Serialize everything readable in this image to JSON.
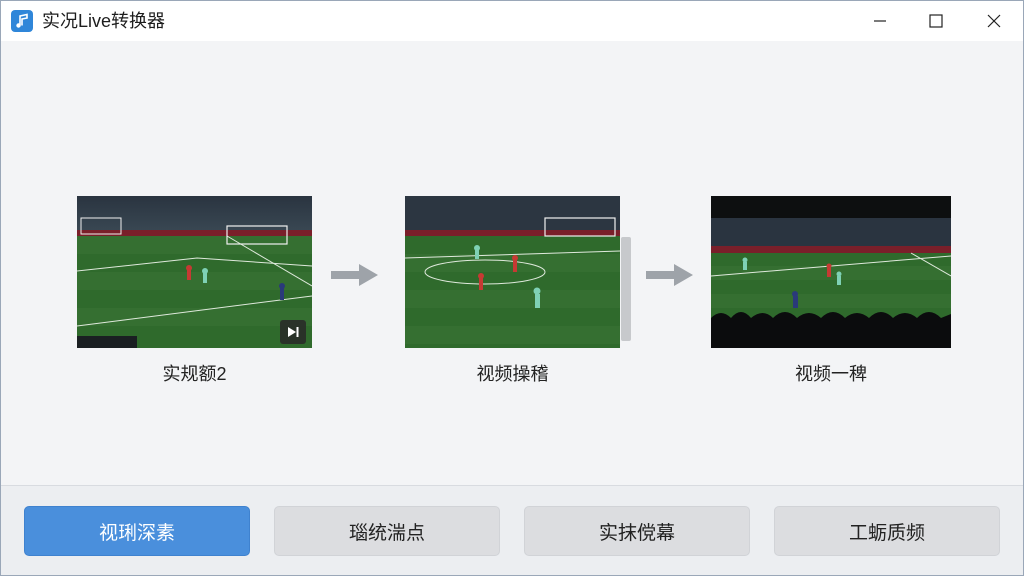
{
  "window": {
    "title": "实况Live转换器",
    "controls": [
      "minimize-icon",
      "maximize-icon",
      "close-icon"
    ]
  },
  "workflow": {
    "steps": [
      {
        "label": "实规额2",
        "thumbnail": "soccer-match-frame",
        "badge_icon": "play-skip-icon"
      },
      {
        "label": "视频操稽",
        "thumbnail": "soccer-match-frame"
      },
      {
        "label": "视频一稗",
        "thumbnail": "soccer-match-widescreen-frame"
      }
    ],
    "arrow_icon": "arrow-right-icon"
  },
  "actions": [
    {
      "label": "视琍深素",
      "style": "primary"
    },
    {
      "label": "瑙统湍点",
      "style": "secondary"
    },
    {
      "label": "实抹傥幕",
      "style": "secondary"
    },
    {
      "label": "工蛎质频",
      "style": "secondary"
    }
  ],
  "colors": {
    "accent": "#4a8fdc",
    "app_icon": "#2f86d9",
    "window_bg": "#f3f4f6",
    "button_bg": "#dcdde0",
    "pitch_green": "#2f6a2c"
  }
}
